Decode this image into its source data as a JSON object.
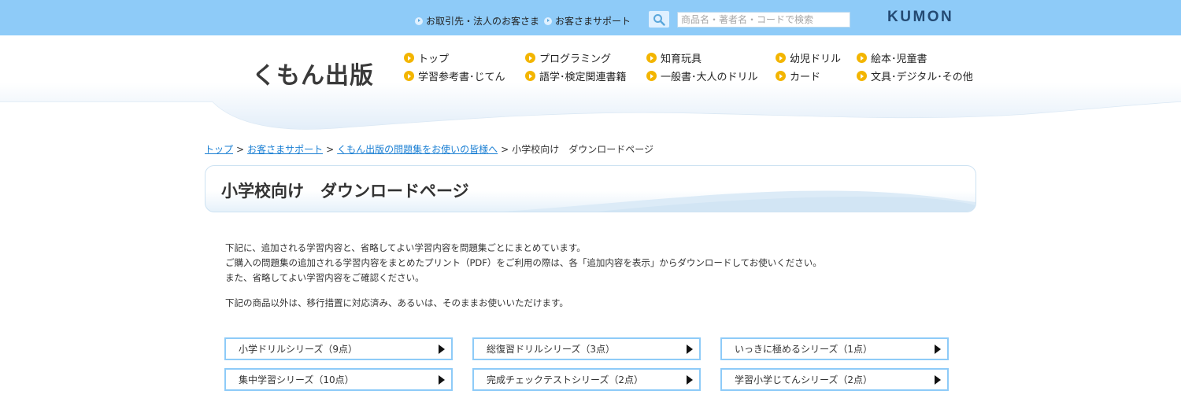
{
  "topbar": {
    "links": [
      "お取引先・法人のお客さま",
      "お客さまサポート"
    ],
    "search_placeholder": "商品名・著者名・コードで検索",
    "brand": "KUMON"
  },
  "header": {
    "logo": "くもん出版",
    "nav": [
      "トップ",
      "学習参考書･じてん",
      "プログラミング",
      "語学･検定関連書籍",
      "知育玩具",
      "一般書･大人のドリル",
      "幼児ドリル",
      "カード",
      "絵本･児童書",
      "文具･デジタル･その他"
    ]
  },
  "breadcrumb": {
    "items": [
      "トップ",
      "お客さまサポート",
      "くもん出版の問題集をお使いの皆様へ"
    ],
    "current": "小学校向け　ダウンロードページ",
    "separator": ">"
  },
  "page": {
    "title": "小学校向け　ダウンロードページ",
    "intro": [
      "下記に、追加される学習内容と、省略してよい学習内容を問題集ごとにまとめています。",
      "ご購入の問題集の追加される学習内容をまとめたプリント（PDF）をご利用の際は、各「追加内容を表示」からダウンロードしてお使いください。",
      "また、省略してよい学習内容をご確認ください。"
    ],
    "note": "下記の商品以外は、移行措置に対応済み、あるいは、そのままお使いいただけます。"
  },
  "series": [
    "小学ドリルシリーズ（9点）",
    "総復習ドリルシリーズ（3点）",
    "いっきに極めるシリーズ（1点）",
    "集中学習シリーズ（10点）",
    "完成チェックテストシリーズ（2点）",
    "学習小学じてんシリーズ（2点）"
  ],
  "colors": {
    "topbar": "#8ecbf8",
    "nav_bullet": "#f3b500",
    "link": "#1a7fd3",
    "button_border": "#8ecbf8"
  }
}
